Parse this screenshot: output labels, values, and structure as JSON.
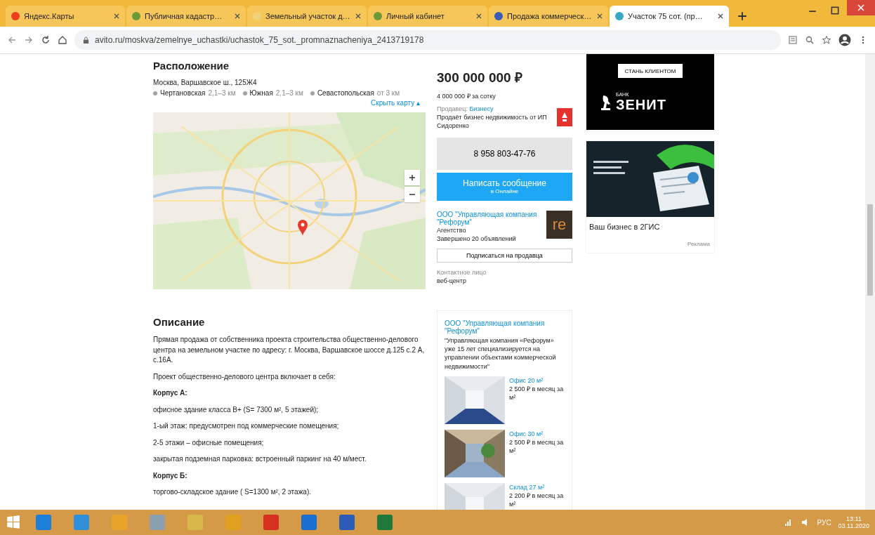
{
  "browser": {
    "tabs": [
      {
        "title": "Яндекс.Карты",
        "selected": false,
        "color": "#e8411c"
      },
      {
        "title": "Публичная кадастр…",
        "selected": false,
        "color": "#6a9a3a"
      },
      {
        "title": "Земельный участок д…",
        "selected": false,
        "color": "#f1d27a"
      },
      {
        "title": "Личный кабинет",
        "selected": false,
        "color": "#6a9a3a"
      },
      {
        "title": "Продажа коммерческ…",
        "selected": false,
        "color": "#3b5bb5"
      },
      {
        "title": "Участок 75 сот. (пр…",
        "selected": true,
        "color": "#37a8c8"
      }
    ],
    "address": "avito.ru/moskva/zemelnye_uchastki/uchastok_75_sot._promnaznacheniya_2413719178"
  },
  "location": {
    "title": "Расположение",
    "address": "Москва, Варшавское ш., 125Ж4",
    "metro": [
      {
        "name": "Чертановская",
        "distance": "2,1–3 км",
        "color": "#a0a2a3"
      },
      {
        "name": "Южная",
        "distance": "2,1–3 км",
        "color": "#a0a2a3"
      },
      {
        "name": "Севастопольская",
        "distance": "от 3 км",
        "color": "#a0a2a3"
      }
    ],
    "map_link": "Скрыть карту ▴"
  },
  "description": {
    "title": "Описание",
    "paragraphs": [
      {
        "kind": "text",
        "text": "Прямая продажа от собственника проекта строительства общественно-делового центра на земельном участке по адресу: г. Москва, Варшавское шоссе д.125 с.2 А, с.16А."
      },
      {
        "kind": "text",
        "text": "Проект общественно-делового центра включает в себя:"
      },
      {
        "kind": "heading",
        "text": "Корпус А:"
      },
      {
        "kind": "text",
        "text": "офисное здание класса В+ (S= 7300 м², 5 этажей);"
      },
      {
        "kind": "text",
        "text": "1-ый этаж: предусмотрен под коммерческие помещения;"
      },
      {
        "kind": "text",
        "text": "2-5 этажи – офисные помещения;"
      },
      {
        "kind": "text",
        "text": "закрытая подземная парковка: встроенный паркинг на 40 м/мест."
      },
      {
        "kind": "heading",
        "text": "Корпус Б:"
      },
      {
        "kind": "text",
        "text": "торгово-складское здание ( S=1300 м², 2 этажа)."
      }
    ]
  },
  "seller": {
    "price": "300 000 000 ₽",
    "per_unit": "4 000 000 ₽ за сотку",
    "label": "Продавец:",
    "label_link": "Бизнесу",
    "note": "Продаёт бизнес недвижимость от ИП Сидоренко",
    "phone": "8 958 803-47-76",
    "message": "Написать сообщение",
    "message_sub": "в Онлайне",
    "company": "ООО \"Управляющая компания \"Рефорум\"",
    "company_kind": "Агентство",
    "completed": "Завершено 20 объявлений",
    "logo": "re",
    "subscribe": "Подписаться на продавца",
    "contact_label": "Контактное лицо",
    "contact": "веб-центр"
  },
  "offers": {
    "company": "ООО \"Управляющая компания \"Рефорум\"",
    "about": "\"Управляющая компания «Рефорум» уже 15 лет специализируется на управлении объектами коммерческой недвижимости\"",
    "items": [
      {
        "title": "Офис 20 м²",
        "price": "2 500 ₽ в месяц за м²"
      },
      {
        "title": "Офис 30 м²",
        "price": "2 500 ₽ в месяц за м²"
      },
      {
        "title": "Склад 27 м²",
        "price": "2 200 ₽ в месяц за м²"
      }
    ]
  },
  "ads": [
    {
      "kind": "bank",
      "button": "СТАНЬ КЛИЕНТОМ",
      "bank": "БАНК",
      "name": "ЗЕНИТ"
    },
    {
      "kind": "picture",
      "caption": "Ваш бизнес в 2ГИС",
      "label": "Реклама"
    }
  ],
  "taskbar": {
    "language": "РУС",
    "time": "13:11",
    "date": "03.11.2020"
  }
}
